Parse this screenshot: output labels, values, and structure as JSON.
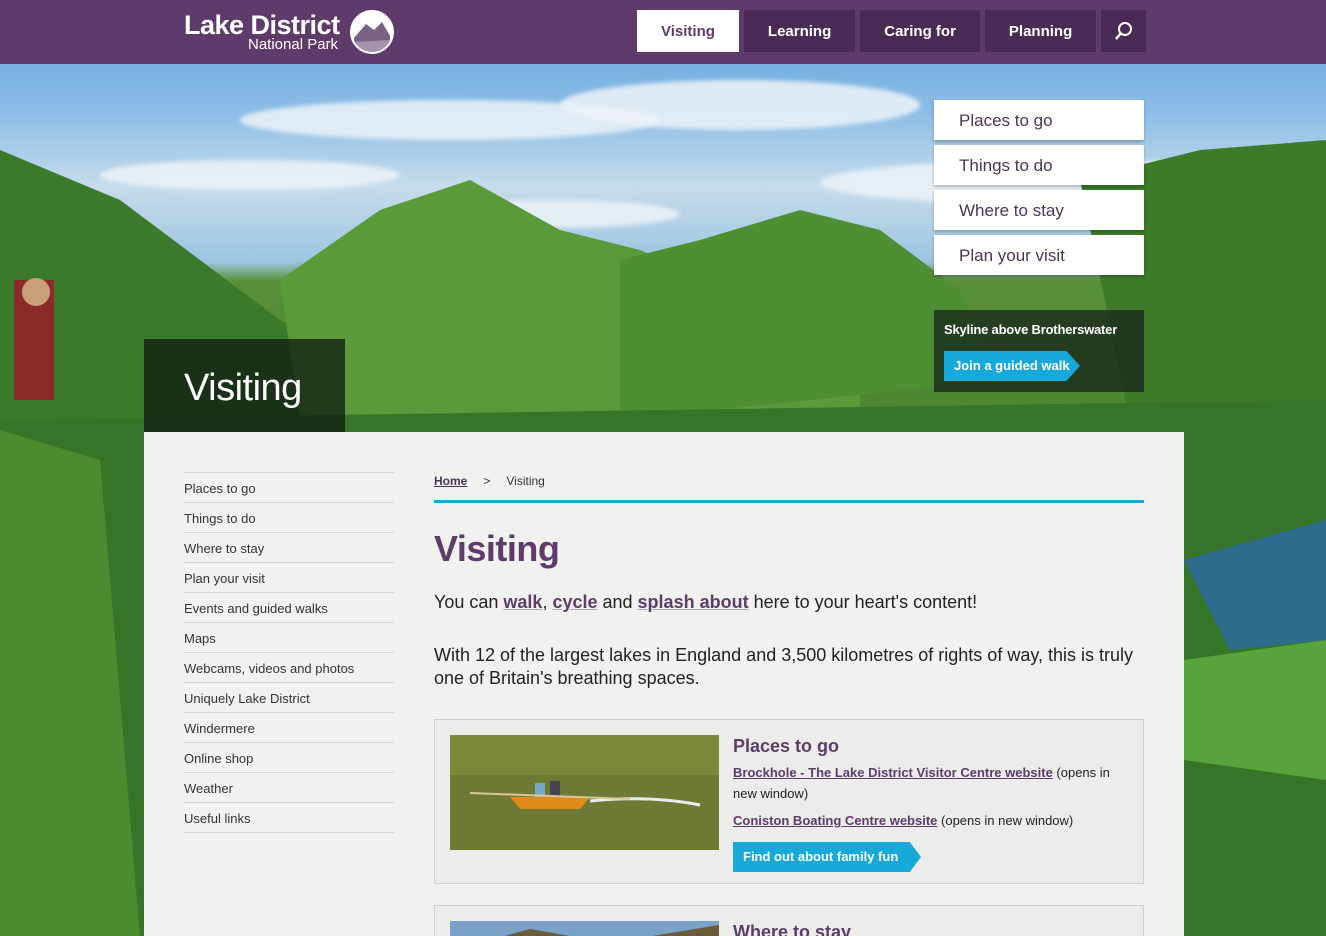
{
  "header": {
    "logo_title": "Lake District",
    "logo_subtitle": "National Park",
    "nav": [
      {
        "label": "Visiting",
        "active": true
      },
      {
        "label": "Learning",
        "active": false
      },
      {
        "label": "Caring for",
        "active": false
      },
      {
        "label": "Planning",
        "active": false
      }
    ],
    "search_icon": "search-icon"
  },
  "quick_links": [
    "Places to go",
    "Things to do",
    "Where to stay",
    "Plan your visit"
  ],
  "hero": {
    "caption": "Skyline above Brotherswater",
    "caption_button": "Join a guided walk",
    "title": "Visiting"
  },
  "sidebar": {
    "items": [
      "Places to go",
      "Things to do",
      "Where to stay",
      "Plan your visit",
      "Events and guided walks",
      "Maps",
      "Webcams, videos and photos",
      "Uniquely Lake District",
      "Windermere",
      "Online shop",
      "Weather",
      "Useful links"
    ]
  },
  "breadcrumb": {
    "home": "Home",
    "separator": ">",
    "current": "Visiting"
  },
  "main": {
    "title": "Visiting",
    "intro": {
      "before": "You can ",
      "link1": "walk",
      "sep1": ", ",
      "link2": "cycle",
      "sep2": " and ",
      "link3": "splash about",
      "after": " here to your heart's content!"
    },
    "paragraph": "With 12 of the largest lakes in England and 3,500 kilometres of rights of way, this is truly one of Britain's breathing spaces.",
    "cards": [
      {
        "title": "Places to go",
        "link1": "Brockhole - The Lake District Visitor Centre website",
        "link1_suffix": " (opens in new window)",
        "link2": "Coniston Boating Centre website",
        "link2_suffix": " (opens in new window)",
        "button": "Find out about family fun"
      },
      {
        "title": "Where to stay"
      }
    ]
  },
  "colors": {
    "brand_purple": "#5e3b6b",
    "accent_blue": "#17a9d9",
    "panel_bg": "#f1f1ef"
  }
}
